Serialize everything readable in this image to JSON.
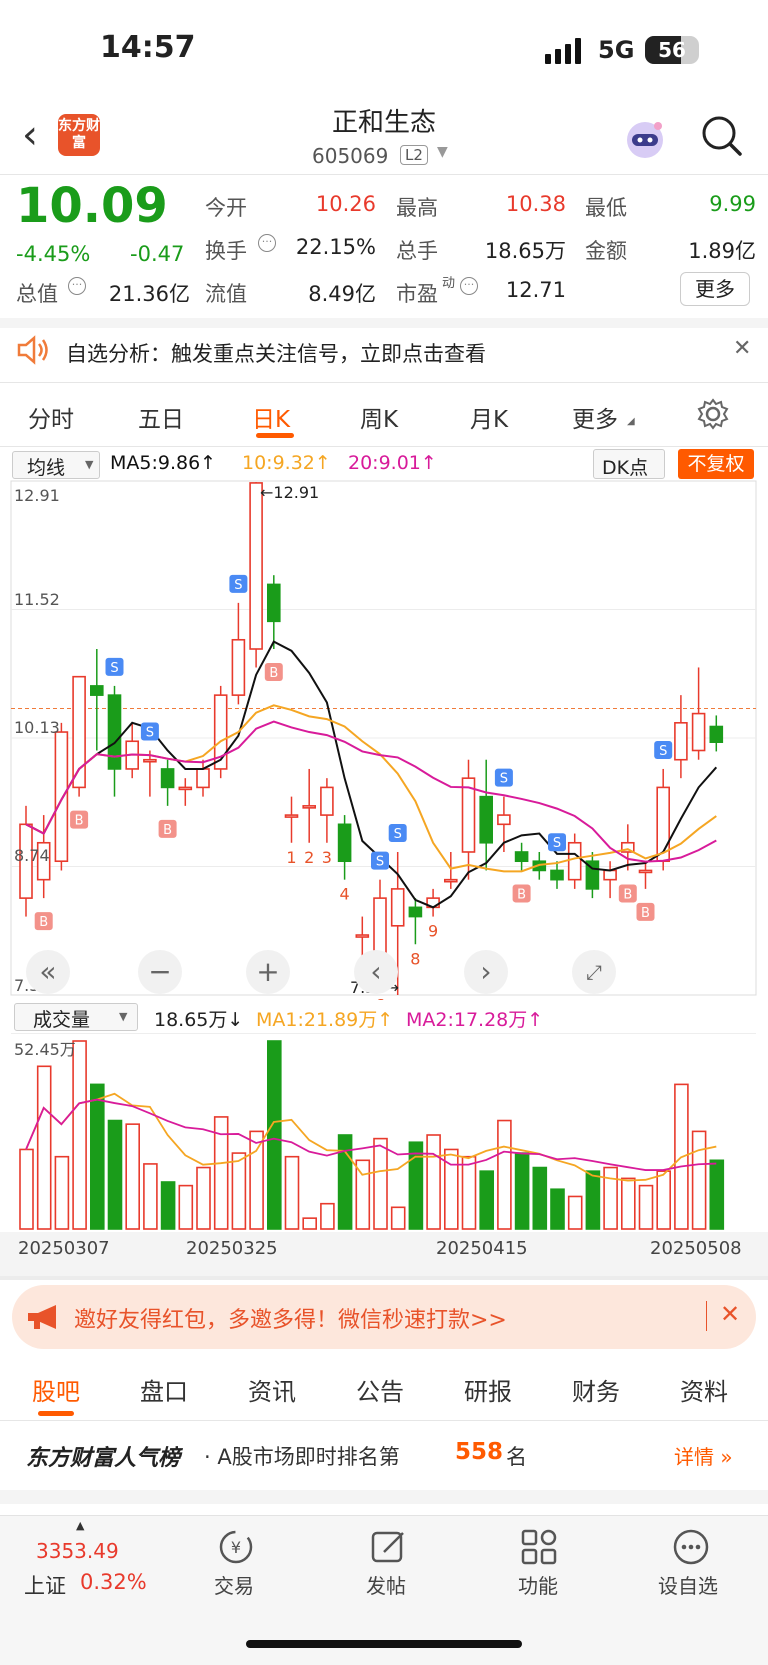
{
  "status": {
    "time": "14:57",
    "network": "5G",
    "battery": "56"
  },
  "header": {
    "title": "正和生态",
    "code": "605069",
    "level": "L2",
    "logo_text": "东方财富"
  },
  "quote": {
    "price": "10.09",
    "change_pct": "-4.45%",
    "change": "-0.47",
    "open_label": "今开",
    "open": "10.26",
    "high_label": "最高",
    "high": "10.38",
    "low_label": "最低",
    "low": "9.99",
    "turnover_label": "换手",
    "turnover": "22.15%",
    "volume_label": "总手",
    "volume": "18.65万",
    "amount_label": "金额",
    "amount": "1.89亿",
    "mktcap_label": "总值",
    "mktcap": "21.36亿",
    "float_label": "流值",
    "float": "8.49亿",
    "pe_label": "市盈",
    "pe_sup": "动",
    "pe": "12.71",
    "more": "更多"
  },
  "notice": {
    "text": "自选分析：触发重点关注信号，立即点击查看"
  },
  "chart_tabs": [
    "分时",
    "五日",
    "日K",
    "周K",
    "月K",
    "更多"
  ],
  "ma": {
    "selector": "均线",
    "ma5": "MA5:9.86↑",
    "ma10": "10:9.32↑",
    "ma20": "20:9.01↑",
    "dk": "DK点",
    "adjust": "不复权"
  },
  "axis": {
    "max": "12.91",
    "y2": "11.52",
    "y3": "10.13",
    "y4": "8.74",
    "min": "7.35",
    "max_marker": "←12.91",
    "min_marker": "7.35→"
  },
  "volume": {
    "selector": "成交量",
    "value": "18.65万↓",
    "ma1": "MA1:21.89万↑",
    "ma2": "MA2:17.28万↑",
    "max": "52.45万"
  },
  "dates": [
    "20250307",
    "20250325",
    "20250415",
    "20250508"
  ],
  "banner": {
    "text": "邀好友得红包，多邀多得！微信秒速打款>>"
  },
  "section_tabs": [
    "股吧",
    "盘口",
    "资讯",
    "公告",
    "研报",
    "财务",
    "资料"
  ],
  "rank": {
    "brand": "东方财富人气榜",
    "text": "· A股市场即时排名第",
    "num": "558",
    "unit": "名",
    "detail": "详情 »"
  },
  "index": {
    "value": "3353.49",
    "name": "上证",
    "pct": "0.32%"
  },
  "bottom_nav": [
    "交易",
    "发帖",
    "功能",
    "设自选"
  ],
  "colors": {
    "up": "#e83a2c",
    "down": "#1a9c1a",
    "accent": "#ff5a00",
    "ma5": "#111111",
    "ma10": "#f5a623",
    "ma20": "#d81b9a"
  },
  "chart_data": {
    "type": "candlestick",
    "title": "",
    "ylim": [
      7.35,
      12.91
    ],
    "x_ticks": [
      "20250307",
      "20250325",
      "20250415",
      "20250508"
    ],
    "candles": [
      {
        "o": 8.4,
        "c": 9.2,
        "h": 9.4,
        "l": 8.2
      },
      {
        "o": 8.6,
        "c": 9.0,
        "h": 9.3,
        "l": 8.4
      },
      {
        "o": 8.8,
        "c": 10.2,
        "h": 10.3,
        "l": 8.7
      },
      {
        "o": 9.6,
        "c": 10.8,
        "h": 10.8,
        "l": 9.5
      },
      {
        "o": 10.7,
        "c": 10.6,
        "h": 11.1,
        "l": 10.0
      },
      {
        "o": 10.6,
        "c": 9.8,
        "h": 10.7,
        "l": 9.5
      },
      {
        "o": 9.8,
        "c": 10.1,
        "h": 10.3,
        "l": 9.7
      },
      {
        "o": 9.9,
        "c": 9.9,
        "h": 10.0,
        "l": 9.5
      },
      {
        "o": 9.8,
        "c": 9.6,
        "h": 9.9,
        "l": 9.4
      },
      {
        "o": 9.6,
        "c": 9.6,
        "h": 9.7,
        "l": 9.4
      },
      {
        "o": 9.6,
        "c": 9.8,
        "h": 9.9,
        "l": 9.5
      },
      {
        "o": 9.8,
        "c": 10.6,
        "h": 10.7,
        "l": 9.7
      },
      {
        "o": 10.6,
        "c": 11.2,
        "h": 11.6,
        "l": 10.5
      },
      {
        "o": 11.1,
        "c": 12.9,
        "h": 12.91,
        "l": 10.9
      },
      {
        "o": 11.8,
        "c": 11.4,
        "h": 11.9,
        "l": 11.1
      },
      {
        "o": 9.3,
        "c": 9.3,
        "h": 9.5,
        "l": 9.0
      },
      {
        "o": 9.4,
        "c": 9.4,
        "h": 9.8,
        "l": 9.0
      },
      {
        "o": 9.3,
        "c": 9.6,
        "h": 9.7,
        "l": 9.0
      },
      {
        "o": 9.2,
        "c": 8.8,
        "h": 9.3,
        "l": 8.6
      },
      {
        "o": 8.0,
        "c": 8.0,
        "h": 8.2,
        "l": 7.7
      },
      {
        "o": 7.7,
        "c": 8.4,
        "h": 8.6,
        "l": 7.4
      },
      {
        "o": 8.1,
        "c": 8.5,
        "h": 8.9,
        "l": 7.35
      },
      {
        "o": 8.3,
        "c": 8.2,
        "h": 8.4,
        "l": 7.9
      },
      {
        "o": 8.3,
        "c": 8.4,
        "h": 8.5,
        "l": 8.2
      },
      {
        "o": 8.6,
        "c": 8.6,
        "h": 8.9,
        "l": 8.5
      },
      {
        "o": 8.9,
        "c": 9.7,
        "h": 9.9,
        "l": 8.6
      },
      {
        "o": 9.5,
        "c": 9.0,
        "h": 9.9,
        "l": 8.7
      },
      {
        "o": 9.2,
        "c": 9.3,
        "h": 9.5,
        "l": 8.9
      },
      {
        "o": 8.9,
        "c": 8.8,
        "h": 9.0,
        "l": 8.7
      },
      {
        "o": 8.8,
        "c": 8.7,
        "h": 8.9,
        "l": 8.6
      },
      {
        "o": 8.7,
        "c": 8.6,
        "h": 8.8,
        "l": 8.5
      },
      {
        "o": 8.6,
        "c": 9.0,
        "h": 9.1,
        "l": 8.5
      },
      {
        "o": 8.8,
        "c": 8.5,
        "h": 8.9,
        "l": 8.4
      },
      {
        "o": 8.6,
        "c": 8.7,
        "h": 8.8,
        "l": 8.4
      },
      {
        "o": 8.9,
        "c": 9.0,
        "h": 9.2,
        "l": 8.7
      },
      {
        "o": 8.7,
        "c": 8.7,
        "h": 8.8,
        "l": 8.5
      },
      {
        "o": 8.8,
        "c": 9.6,
        "h": 9.8,
        "l": 8.7
      },
      {
        "o": 9.9,
        "c": 10.3,
        "h": 10.6,
        "l": 9.7
      },
      {
        "o": 10.0,
        "c": 10.4,
        "h": 10.9,
        "l": 9.9
      },
      {
        "o": 10.26,
        "c": 10.09,
        "h": 10.38,
        "l": 9.99
      }
    ],
    "volumes": [
      22,
      45,
      20,
      52,
      40,
      30,
      29,
      18,
      13,
      12,
      17,
      31,
      21,
      27,
      52,
      20,
      3,
      7,
      26,
      19,
      25,
      6,
      24,
      26,
      22,
      20,
      16,
      30,
      21,
      17,
      11,
      9,
      16,
      17,
      14,
      12,
      16,
      40,
      27,
      19
    ],
    "signals": [
      {
        "i": 1,
        "t": "B"
      },
      {
        "i": 3,
        "t": "B"
      },
      {
        "i": 5,
        "t": "S"
      },
      {
        "i": 7,
        "t": "S"
      },
      {
        "i": 8,
        "t": "B"
      },
      {
        "i": 12,
        "t": "S"
      },
      {
        "i": 14,
        "t": "B"
      },
      {
        "i": 20,
        "t": "S"
      },
      {
        "i": 21,
        "t": "S"
      },
      {
        "i": 27,
        "t": "S"
      },
      {
        "i": 28,
        "t": "B"
      },
      {
        "i": 30,
        "t": "S"
      },
      {
        "i": 34,
        "t": "B"
      },
      {
        "i": 35,
        "t": "B"
      },
      {
        "i": 36,
        "t": "S"
      }
    ],
    "counts": [
      {
        "i": 15,
        "t": "1"
      },
      {
        "i": 16,
        "t": "2"
      },
      {
        "i": 17,
        "t": "3"
      },
      {
        "i": 18,
        "t": "4"
      },
      {
        "i": 19,
        "t": "5"
      },
      {
        "i": 20,
        "t": "6"
      },
      {
        "i": 21,
        "t": "7"
      },
      {
        "i": 22,
        "t": "8"
      },
      {
        "i": 23,
        "t": "9"
      }
    ]
  }
}
